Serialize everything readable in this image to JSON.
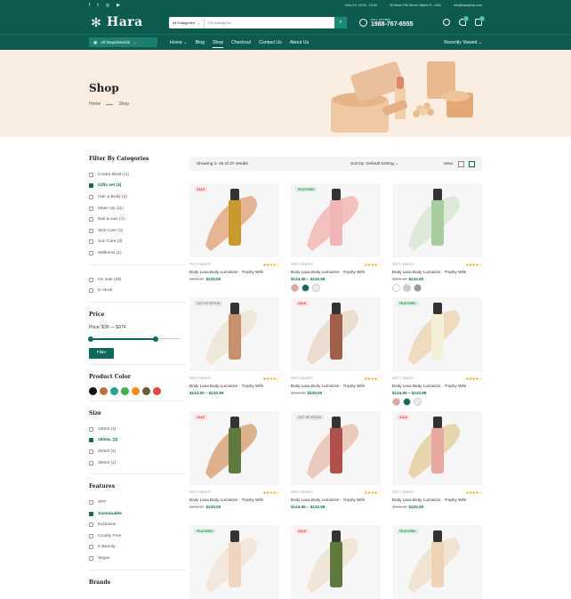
{
  "topbar": {
    "social": [
      "f",
      "t",
      "◎",
      "▶"
    ],
    "hours": "Mon-Fri: 10:00 - 19:00",
    "address": "35 West 27th Street, Miami FL, USA",
    "email": "info@harashop.com"
  },
  "header": {
    "logo": "Hara",
    "search_category": "All Categories",
    "search_placeholder": "I'm looking for...",
    "call_label": "CALL US FREE:",
    "phone": "1988-767-6555",
    "wishlist_count": "0",
    "cart_count": "0"
  },
  "nav": {
    "departments": "All Departments",
    "items": [
      {
        "label": "Home ⌄",
        "active": false
      },
      {
        "label": "Blog",
        "active": false
      },
      {
        "label": "Shop",
        "active": true
      },
      {
        "label": "Checkout",
        "active": false
      },
      {
        "label": "Contact Us",
        "active": false
      },
      {
        "label": "About Us",
        "active": false
      }
    ],
    "recent": "Recently Viewed ⌄"
  },
  "hero": {
    "title": "Shop",
    "crumb_home": "Home",
    "crumb_current": "Shop"
  },
  "sidebar": {
    "cat_title": "Filter By Categories",
    "categories": [
      {
        "label": "Cream Blush (1)",
        "checked": false
      },
      {
        "label": "Gifts set (3)",
        "checked": true
      },
      {
        "label": "Hair & Body (3)",
        "checked": false
      },
      {
        "label": "Make Up (11)",
        "checked": false
      },
      {
        "label": "Nail & wax (1)",
        "checked": false
      },
      {
        "label": "Skin Care (2)",
        "checked": false
      },
      {
        "label": "Sun Care (3)",
        "checked": false
      },
      {
        "label": "Wellness (1)",
        "checked": false
      }
    ],
    "stock": [
      {
        "label": "On sale (29)",
        "checked": false
      },
      {
        "label": "In stock",
        "checked": false
      }
    ],
    "price_title": "Price",
    "price_range": "Price: $39 — $974",
    "price_low": 0,
    "price_high": 0.74,
    "filter_button": "Filter",
    "color_title": "Product Color",
    "colors": [
      "#111111",
      "#b8743e",
      "#1fa392",
      "#3ab54a",
      "#f08c1a",
      "#6b5a3a",
      "#e8453c"
    ],
    "size_title": "Size",
    "sizes": [
      {
        "label": "100ml (3)",
        "checked": false
      },
      {
        "label": "150mL (3)",
        "checked": true
      },
      {
        "label": "200ml (2)",
        "checked": false
      },
      {
        "label": "300ml (1)",
        "checked": false
      }
    ],
    "features_title": "Features",
    "features": [
      {
        "label": "SPF",
        "checked": false
      },
      {
        "label": "Sustainable",
        "checked": true
      },
      {
        "label": "Exclusive",
        "checked": false
      },
      {
        "label": "Cruelty Free",
        "checked": false
      },
      {
        "label": "K Beauty",
        "checked": false
      },
      {
        "label": "Vegan",
        "checked": false
      }
    ],
    "brands_title": "Brands"
  },
  "toolbar": {
    "showing": "Showing 1–18 of 37 results",
    "sort": "Sort by: Default sorting ⌄",
    "view": "View:"
  },
  "products": [
    {
      "tag": "SALE",
      "tag_type": "sale",
      "brand": "PEKTY BEAUTY",
      "stars": "★★★★☆",
      "name": "Body Lava Body Luminizer - Trophy Wife",
      "old": "$199.00",
      "price": "$220.00",
      "variants": [],
      "product": "#c89a2b",
      "swatch": "#e0a882"
    },
    {
      "tag": "FEATURED",
      "tag_type": "featured",
      "brand": "PEKTY BEAUTY",
      "stars": "★★★★☆",
      "name": "Body Lava Body Luminizer - Trophy Wife",
      "old": "",
      "price": "$124.00 – $210.99",
      "variants": [
        "#e7a39a",
        "#0d6b5c",
        "#f1ede6"
      ],
      "product": "#f0b5b5",
      "swatch": "#f2b9b4"
    },
    {
      "tag": "",
      "tag_type": "",
      "brand": "PEKTY BEAUTY",
      "stars": "★★★★☆",
      "name": "Body Lava Body Luminizer - Trophy Wife",
      "old": "$220.00",
      "price": "$210.00",
      "variants": [
        "#ffffff",
        "#cccccc",
        "#999999"
      ],
      "product": "#a8cba0",
      "swatch": "#d8e6d3"
    },
    {
      "tag": "OUT OF STOCK",
      "tag_type": "out",
      "brand": "PEKTY BEAUTY",
      "stars": "★★★★☆",
      "name": "Body Lava Body Luminizer - Trophy Wife",
      "old": "",
      "price": "$124.00 – $210.99",
      "variants": [],
      "product": "#c9906d",
      "swatch": "#efe4d6"
    },
    {
      "tag": "SALE",
      "tag_type": "sale",
      "brand": "PEKTY BEAUTY",
      "stars": "★★★★☆",
      "name": "Body Lava Body Luminizer - Trophy Wife",
      "old": "$229.00",
      "price": "$220.00",
      "variants": [],
      "product": "#a0604a",
      "swatch": "#e9d8c8"
    },
    {
      "tag": "FEATURED",
      "tag_type": "featured",
      "brand": "PEKTY BEAUTY",
      "stars": "★★★★☆",
      "name": "Body Lava Body Luminizer - Trophy Wife",
      "old": "",
      "price": "$124.00 – $210.99",
      "variants": [
        "#e7a39a",
        "#0d6b5c",
        "#f1ede6"
      ],
      "product": "#f4f0d8",
      "swatch": "#ecd6b4"
    },
    {
      "tag": "SALE",
      "tag_type": "sale",
      "brand": "PEKTY BEAUTY",
      "stars": "★★★★☆",
      "name": "Body Lava Body Luminizer - Trophy Wife",
      "old": "$199.00",
      "price": "$220.00",
      "variants": [],
      "product": "#5f7a3c",
      "swatch": "#d9a57a"
    },
    {
      "tag": "OUT OF STOCK",
      "tag_type": "out",
      "brand": "PEKTY BEAUTY",
      "stars": "★★★★☆",
      "name": "Body Lava Body Luminizer - Trophy Wife",
      "old": "",
      "price": "$124.00 – $210.99",
      "variants": [],
      "product": "#b24f4a",
      "swatch": "#e8c2b2"
    },
    {
      "tag": "SALE",
      "tag_type": "sale",
      "brand": "PEKTY BEAUTY",
      "stars": "★★★★☆",
      "name": "Body Lava Body Luminizer - Trophy Wife",
      "old": "$229.00",
      "price": "$220.00",
      "variants": [],
      "product": "#e7a8a0",
      "swatch": "#e4cfa0"
    },
    {
      "tag": "FEATURED",
      "tag_type": "featured",
      "brand": "",
      "stars": "",
      "name": "",
      "old": "",
      "price": "",
      "variants": [],
      "product": "#f0d5c0",
      "swatch": "#f2e4d8"
    },
    {
      "tag": "SALE",
      "tag_type": "sale",
      "brand": "",
      "stars": "",
      "name": "",
      "old": "",
      "price": "",
      "variants": [],
      "product": "#5f7a3c",
      "swatch": "#eee2d0"
    },
    {
      "tag": "FEATURED",
      "tag_type": "featured",
      "brand": "",
      "stars": "",
      "name": "",
      "old": "",
      "price": "",
      "variants": [],
      "product": "#eed3b6",
      "swatch": "#f0e0cc"
    }
  ]
}
